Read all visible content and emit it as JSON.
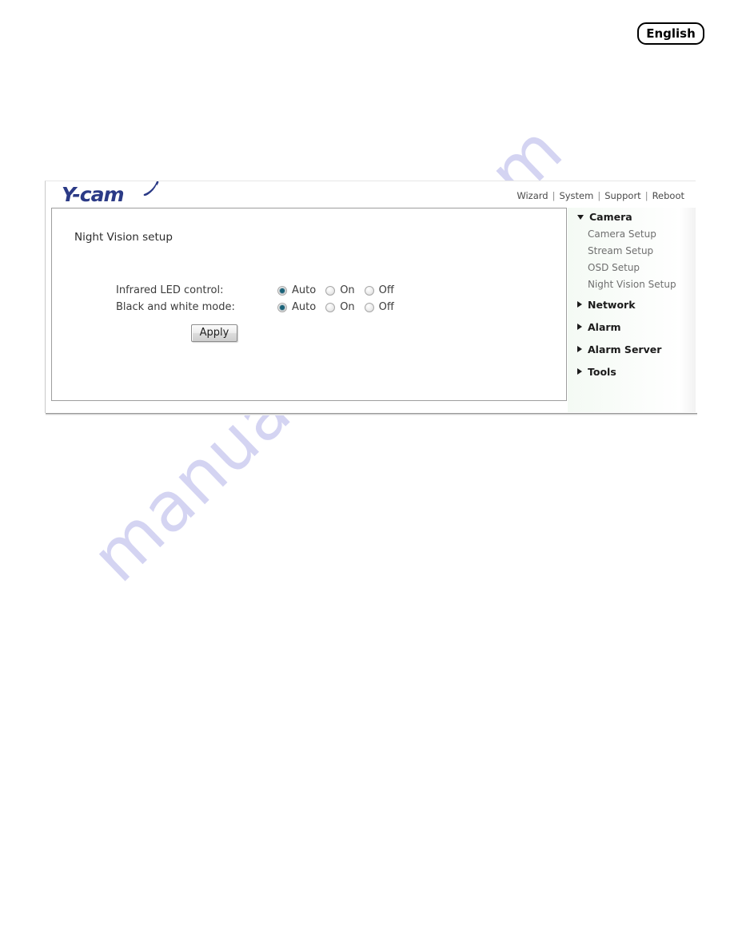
{
  "page": {
    "language_badge": "English",
    "watermark": "manualshive.com"
  },
  "widget": {
    "logo": {
      "text": "Y-cam",
      "icon": "wifi-arc-icon"
    },
    "topnav": {
      "links": [
        "Wizard",
        "System",
        "Support",
        "Reboot"
      ],
      "separator": "|"
    }
  },
  "content": {
    "title": "Night Vision setup",
    "rows": [
      {
        "label": "Infrared LED control:",
        "options": [
          {
            "label": "Auto",
            "selected": true
          },
          {
            "label": "On",
            "selected": false
          },
          {
            "label": "Off",
            "selected": false
          }
        ]
      },
      {
        "label": "Black and white mode:",
        "options": [
          {
            "label": "Auto",
            "selected": true
          },
          {
            "label": "On",
            "selected": false
          },
          {
            "label": "Off",
            "selected": false
          }
        ]
      }
    ],
    "apply_label": "Apply"
  },
  "sidebar": {
    "groups": [
      {
        "label": "Camera",
        "expanded": true,
        "children": [
          "Camera Setup",
          "Stream Setup",
          "OSD Setup",
          "Night Vision Setup"
        ]
      },
      {
        "label": "Network",
        "expanded": false,
        "children": []
      },
      {
        "label": "Alarm",
        "expanded": false,
        "children": []
      },
      {
        "label": "Alarm Server",
        "expanded": false,
        "children": []
      },
      {
        "label": "Tools",
        "expanded": false,
        "children": []
      }
    ]
  },
  "colors": {
    "logo_blue": "#2b3a86",
    "radio_selected": "#1a6379",
    "watermark": "#cdcdf0",
    "sidebar_text": "#6f6f6f",
    "sidebar_group_text": "#1b1b1b"
  }
}
